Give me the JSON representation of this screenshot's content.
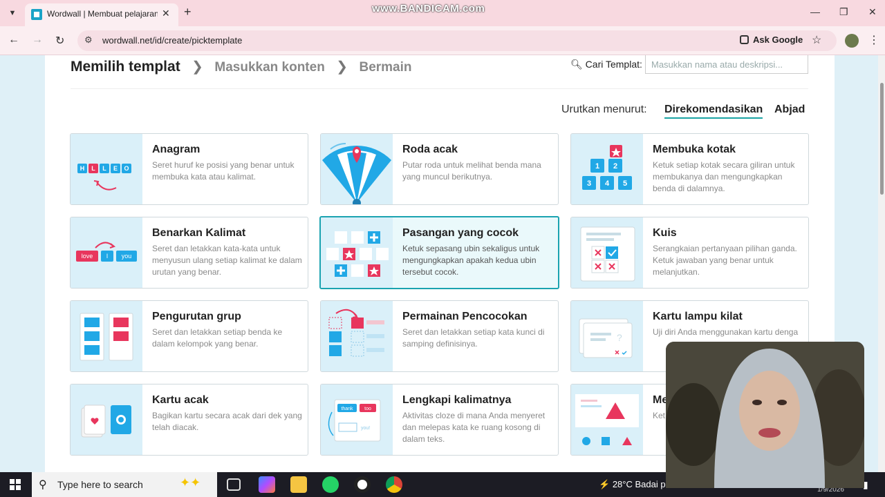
{
  "browser": {
    "tab_title": "Wordwall | Membuat pelajaran",
    "url": "wordwall.net/id/create/picktemplate",
    "ask_google": "Ask Google",
    "watermark": "www.BANDICAM.com"
  },
  "steps": {
    "current": "Memilih templat",
    "step2": "Masukkan konten",
    "step3": "Bermain"
  },
  "search": {
    "label": "Cari Templat:",
    "placeholder": "Masukkan nama atau deskripsi..."
  },
  "sort": {
    "label": "Urutkan menurut:",
    "active": "Direkomendasikan",
    "alpha": "Abjad"
  },
  "templates": [
    {
      "title": "Anagram",
      "desc": "Seret huruf ke posisi yang benar untuk membuka kata atau kalimat."
    },
    {
      "title": "Roda acak",
      "desc": "Putar roda untuk melihat benda mana yang muncul berikutnya."
    },
    {
      "title": "Membuka kotak",
      "desc": "Ketuk setiap kotak secara giliran untuk membukanya dan mengungkapkan benda di dalamnya."
    },
    {
      "title": "Benarkan Kalimat",
      "desc": "Seret dan letakkan kata-kata untuk menyusun ulang setiap kalimat ke dalam urutan yang benar."
    },
    {
      "title": "Pasangan yang cocok",
      "desc": "Ketuk sepasang ubin sekaligus untuk mengungkapkan apakah kedua ubin tersebut cocok."
    },
    {
      "title": "Kuis",
      "desc": "Serangkaian pertanyaan pilihan ganda. Ketuk jawaban yang benar untuk melanjutkan."
    },
    {
      "title": "Pengurutan grup",
      "desc": "Seret dan letakkan setiap benda ke dalam kelompok yang benar."
    },
    {
      "title": "Permainan Pencocokan",
      "desc": "Seret dan letakkan setiap kata kunci di samping definisinya."
    },
    {
      "title": "Kartu lampu kilat",
      "desc": "Uji diri Anda menggunakan kartu denga"
    },
    {
      "title": "Kartu acak",
      "desc": "Bagikan kartu secara acak dari dek yang telah diacak."
    },
    {
      "title": "Lengkapi kalimatnya",
      "desc": "Aktivitas cloze di mana Anda menyeret dan melepas kata ke ruang kosong di dalam teks."
    },
    {
      "title": "Me",
      "desc": "Ket"
    }
  ],
  "thumb_text": {
    "anagram_letters": [
      "H",
      "L",
      "L",
      "E",
      "O"
    ],
    "box_numbers": [
      "1",
      "2",
      "3",
      "4",
      "5"
    ],
    "sentence_words": [
      "love",
      "I",
      "you"
    ],
    "cloze_words": [
      "thank",
      "too",
      "you!"
    ]
  },
  "taskbar": {
    "search_placeholder": "Type here to search",
    "temperature": "28°C",
    "weather": "Badai p",
    "date": "1/9/2026"
  },
  "colors": {
    "accent": "#1aa3b0",
    "brand_red": "#e8365d",
    "brand_blue": "#21a8e6"
  }
}
